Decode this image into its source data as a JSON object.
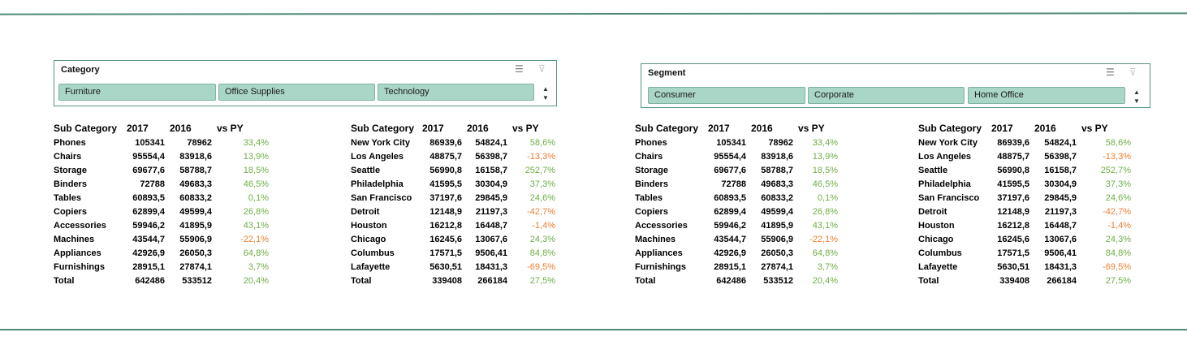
{
  "colors": {
    "accent": "#4f8a78",
    "slicer_item": "#a9d6c6",
    "positive": "#70ad47",
    "negative": "#ed7d31"
  },
  "slicer_controls": {
    "multiselect_icon": "multi-select-icon",
    "clear_filter_icon": "clear-filter-icon"
  },
  "slicers": [
    {
      "title": "Category",
      "items": [
        "Furniture",
        "Office Supplies",
        "Technology"
      ]
    },
    {
      "title": "Segment",
      "items": [
        "Consumer",
        "Corporate",
        "Home Office"
      ]
    }
  ],
  "scroll": {
    "up": "▲",
    "down": "▼"
  },
  "tables": [
    {
      "headers": [
        "Sub Category",
        "2017",
        "2016",
        "vs PY"
      ],
      "rows": [
        [
          "Phones",
          "105341",
          "78962",
          "33,4%"
        ],
        [
          "Chairs",
          "95554,4",
          "83918,6",
          "13,9%"
        ],
        [
          "Storage",
          "69677,6",
          "58788,7",
          "18,5%"
        ],
        [
          "Binders",
          "72788",
          "49683,3",
          "46,5%"
        ],
        [
          "Tables",
          "60893,5",
          "60833,2",
          "0,1%"
        ],
        [
          "Copiers",
          "62899,4",
          "49599,4",
          "26,8%"
        ],
        [
          "Accessories",
          "59946,2",
          "41895,9",
          "43,1%"
        ],
        [
          "Machines",
          "43544,7",
          "55906,9",
          "-22,1%"
        ],
        [
          "Appliances",
          "42926,9",
          "26050,3",
          "64,8%"
        ],
        [
          "Furnishings",
          "28915,1",
          "27874,1",
          "3,7%"
        ],
        [
          "Total",
          "642486",
          "533512",
          "20,4%"
        ]
      ]
    },
    {
      "headers": [
        "Sub Category",
        "2017",
        "2016",
        "vs PY"
      ],
      "rows": [
        [
          "New York City",
          "86939,6",
          "54824,1",
          "58,6%"
        ],
        [
          "Los Angeles",
          "48875,7",
          "56398,7",
          "-13,3%"
        ],
        [
          "Seattle",
          "56990,8",
          "16158,7",
          "252,7%"
        ],
        [
          "Philadelphia",
          "41595,5",
          "30304,9",
          "37,3%"
        ],
        [
          "San Francisco",
          "37197,6",
          "29845,9",
          "24,6%"
        ],
        [
          "Detroit",
          "12148,9",
          "21197,3",
          "-42,7%"
        ],
        [
          "Houston",
          "16212,8",
          "16448,7",
          "-1,4%"
        ],
        [
          "Chicago",
          "16245,6",
          "13067,6",
          "24,3%"
        ],
        [
          "Columbus",
          "17571,5",
          "9506,41",
          "84,8%"
        ],
        [
          "Lafayette",
          "5630,51",
          "18431,3",
          "-69,5%"
        ],
        [
          "Total",
          "339408",
          "266184",
          "27,5%"
        ]
      ]
    },
    {
      "headers": [
        "Sub Category",
        "2017",
        "2016",
        "vs PY"
      ],
      "rows": [
        [
          "Phones",
          "105341",
          "78962",
          "33,4%"
        ],
        [
          "Chairs",
          "95554,4",
          "83918,6",
          "13,9%"
        ],
        [
          "Storage",
          "69677,6",
          "58788,7",
          "18,5%"
        ],
        [
          "Binders",
          "72788",
          "49683,3",
          "46,5%"
        ],
        [
          "Tables",
          "60893,5",
          "60833,2",
          "0,1%"
        ],
        [
          "Copiers",
          "62899,4",
          "49599,4",
          "26,8%"
        ],
        [
          "Accessories",
          "59946,2",
          "41895,9",
          "43,1%"
        ],
        [
          "Machines",
          "43544,7",
          "55906,9",
          "-22,1%"
        ],
        [
          "Appliances",
          "42926,9",
          "26050,3",
          "64,8%"
        ],
        [
          "Furnishings",
          "28915,1",
          "27874,1",
          "3,7%"
        ],
        [
          "Total",
          "642486",
          "533512",
          "20,4%"
        ]
      ]
    },
    {
      "headers": [
        "Sub Category",
        "2017",
        "2016",
        "vs PY"
      ],
      "rows": [
        [
          "New York City",
          "86939,6",
          "54824,1",
          "58,6%"
        ],
        [
          "Los Angeles",
          "48875,7",
          "56398,7",
          "-13,3%"
        ],
        [
          "Seattle",
          "56990,8",
          "16158,7",
          "252,7%"
        ],
        [
          "Philadelphia",
          "41595,5",
          "30304,9",
          "37,3%"
        ],
        [
          "San Francisco",
          "37197,6",
          "29845,9",
          "24,6%"
        ],
        [
          "Detroit",
          "12148,9",
          "21197,3",
          "-42,7%"
        ],
        [
          "Houston",
          "16212,8",
          "16448,7",
          "-1,4%"
        ],
        [
          "Chicago",
          "16245,6",
          "13067,6",
          "24,3%"
        ],
        [
          "Columbus",
          "17571,5",
          "9506,41",
          "84,8%"
        ],
        [
          "Lafayette",
          "5630,51",
          "18431,3",
          "-69,5%"
        ],
        [
          "Total",
          "339408",
          "266184",
          "27,5%"
        ]
      ]
    }
  ]
}
